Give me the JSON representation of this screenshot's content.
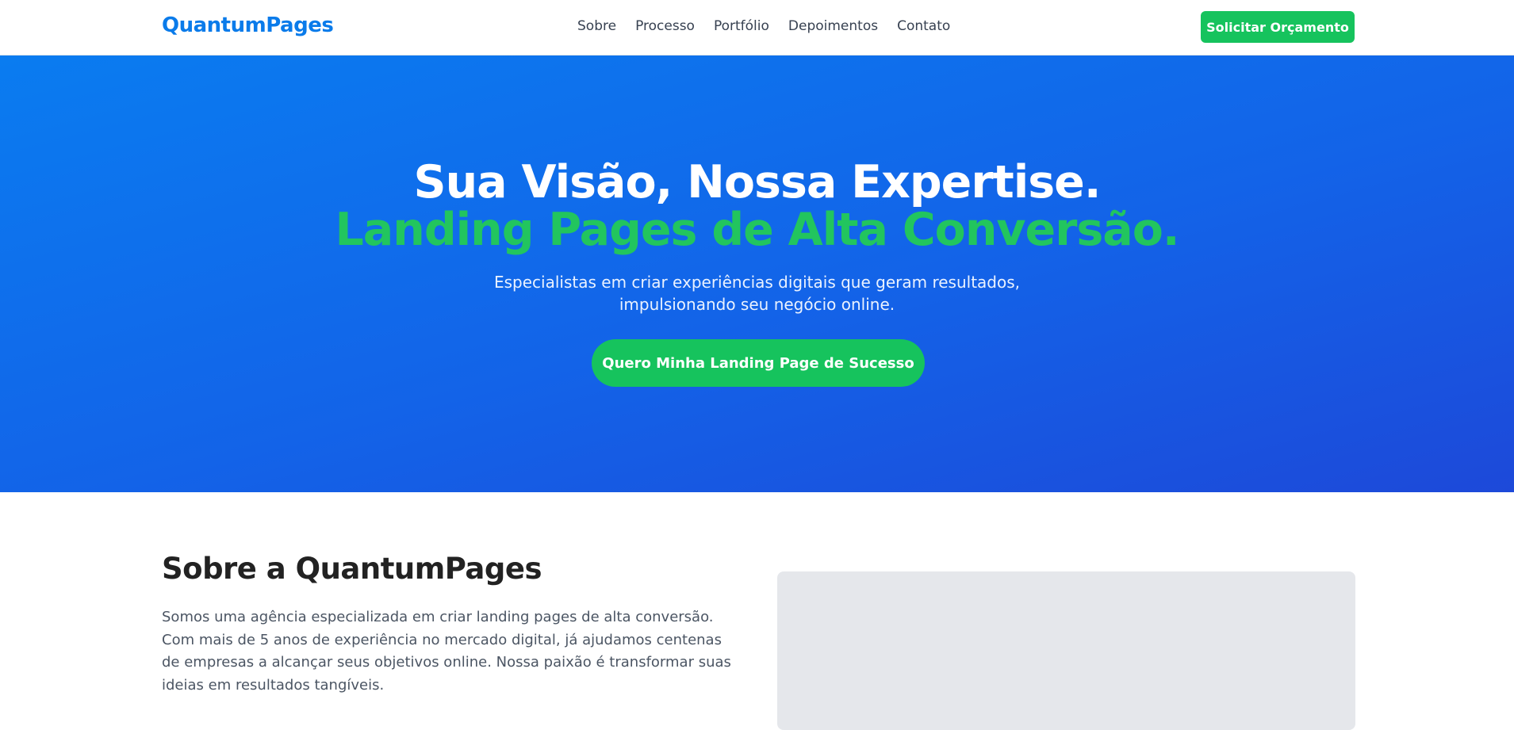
{
  "brand": {
    "name": "QuantumPages"
  },
  "nav": {
    "links": [
      "Sobre",
      "Processo",
      "Portfólio",
      "Depoimentos",
      "Contato"
    ],
    "cta_label": "Solicitar Orçamento"
  },
  "hero": {
    "title": "Sua Visão, Nossa Expertise.",
    "title_accent": "Landing Pages de Alta Conversão.",
    "subtitle_line1": "Especialistas em criar experiências digitais que geram resultados,",
    "subtitle_line2": "impulsionando seu negócio online.",
    "cta_label": "Quero Minha Landing Page de Sucesso"
  },
  "about": {
    "title": "Sobre a QuantumPages",
    "text": "Somos uma agência especializada em criar landing pages de alta conversão. Com mais de 5 anos de experiência no mercado digital, já ajudamos centenas de empresas a alcançar seus objetivos online. Nossa paixão é transformar suas ideias em resultados tangíveis."
  },
  "colors": {
    "brand_blue": "#0a7bea",
    "accent_green": "#16c35d",
    "hero_gradient_start": "#0a7cf0",
    "hero_gradient_end": "#1d49d9",
    "placeholder_gray": "#e5e7eb"
  }
}
